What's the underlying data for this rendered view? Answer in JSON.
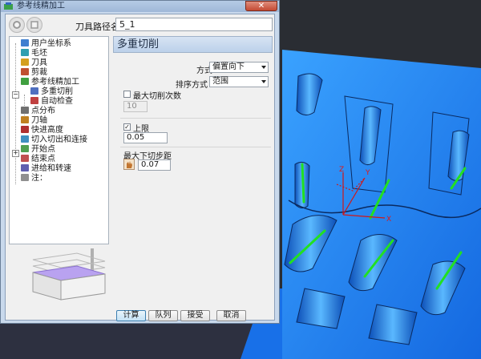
{
  "window": {
    "title": "参考线精加工",
    "close_symbol": "✕"
  },
  "header": {
    "path_name_label": "刀具路径名称",
    "path_name_value": "5_1"
  },
  "tree": {
    "items": [
      {
        "label": "用户坐标系",
        "icon": "ucs-icon",
        "color": "#3f7fd0"
      },
      {
        "label": "毛坯",
        "icon": "block-icon",
        "color": "#2f9fb0"
      },
      {
        "label": "刀具",
        "icon": "tool-icon",
        "color": "#d4a020"
      },
      {
        "label": "剪裁",
        "icon": "trim-icon",
        "color": "#c05030"
      },
      {
        "label": "参考线精加工",
        "icon": "pattern-finish-icon",
        "color": "#40a040"
      },
      {
        "label": "多重切削",
        "icon": "multiple-cuts-icon",
        "color": "#5070c0"
      },
      {
        "label": "自动检查",
        "icon": "auto-verify-icon",
        "color": "#c04040"
      },
      {
        "label": "点分布",
        "icon": "point-distribution-icon",
        "color": "#707070"
      },
      {
        "label": "刀轴",
        "icon": "tool-axis-icon",
        "color": "#c08020"
      },
      {
        "label": "快进高度",
        "icon": "rapid-height-icon",
        "color": "#b03030"
      },
      {
        "label": "切入切出和连接",
        "icon": "leads-links-icon",
        "color": "#4090c0"
      },
      {
        "label": "开始点",
        "icon": "start-point-icon",
        "color": "#50a050"
      },
      {
        "label": "结束点",
        "icon": "end-point-icon",
        "color": "#c05050"
      },
      {
        "label": "进给和转速",
        "icon": "feeds-speeds-icon",
        "color": "#6060b0"
      },
      {
        "label": "注：",
        "icon": "notes-icon",
        "color": "#909090"
      }
    ]
  },
  "panel": {
    "title": "多重切削",
    "mode_label": "方式",
    "mode_value": "偏置向下",
    "order_label": "排序方式",
    "order_value": "范围",
    "max_cuts_label": "最大切削次数",
    "max_cuts_checked": false,
    "max_cuts_value": "10",
    "upper_limit_label": "上限",
    "upper_limit_checked": true,
    "upper_limit_value": "0.05",
    "max_stepdown_label": "最大下切步距",
    "max_stepdown_value": "0.07",
    "check_mark": "✓"
  },
  "buttons": {
    "calculate": "计算",
    "queue": "队列",
    "accept": "接受",
    "cancel": "取消"
  },
  "viewport": {
    "background": "#2a2d33",
    "part_color": "#1e90ff",
    "toolpath_color": "#22e022",
    "axis_labels": {
      "x": "X",
      "y": "Y",
      "z": "Z"
    },
    "axis_color": "#d01818"
  }
}
